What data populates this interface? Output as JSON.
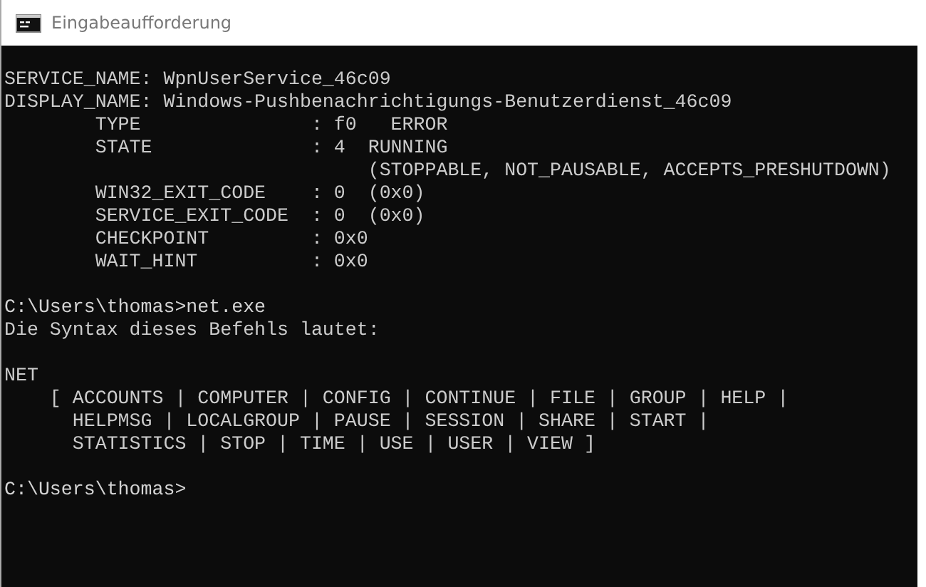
{
  "window": {
    "title": "Eingabeaufforderung"
  },
  "console": {
    "lines": [
      {
        "kind": "blank"
      },
      {
        "kind": "output",
        "text": "SERVICE_NAME: WpnUserService_46c09"
      },
      {
        "kind": "output",
        "text": "DISPLAY_NAME: Windows-Pushbenachrichtigungs-Benutzerdienst_46c09"
      },
      {
        "kind": "output",
        "text": "        TYPE               : f0   ERROR"
      },
      {
        "kind": "output",
        "text": "        STATE              : 4  RUNNING"
      },
      {
        "kind": "output",
        "text": "                                (STOPPABLE, NOT_PAUSABLE, ACCEPTS_PRESHUTDOWN)"
      },
      {
        "kind": "output",
        "text": "        WIN32_EXIT_CODE    : 0  (0x0)"
      },
      {
        "kind": "output",
        "text": "        SERVICE_EXIT_CODE  : 0  (0x0)"
      },
      {
        "kind": "output",
        "text": "        CHECKPOINT         : 0x0"
      },
      {
        "kind": "output",
        "text": "        WAIT_HINT          : 0x0"
      },
      {
        "kind": "blank"
      },
      {
        "kind": "prompt",
        "text": "C:\\Users\\thomas>net.exe"
      },
      {
        "kind": "output",
        "text": "Die Syntax dieses Befehls lautet:"
      },
      {
        "kind": "blank"
      },
      {
        "kind": "output",
        "text": "NET"
      },
      {
        "kind": "output",
        "text": "    [ ACCOUNTS | COMPUTER | CONFIG | CONTINUE | FILE | GROUP | HELP |"
      },
      {
        "kind": "output",
        "text": "      HELPMSG | LOCALGROUP | PAUSE | SESSION | SHARE | START |"
      },
      {
        "kind": "output",
        "text": "      STATISTICS | STOP | TIME | USE | USER | VIEW ]"
      },
      {
        "kind": "blank"
      },
      {
        "kind": "prompt",
        "text": "C:\\Users\\thomas>"
      }
    ]
  }
}
